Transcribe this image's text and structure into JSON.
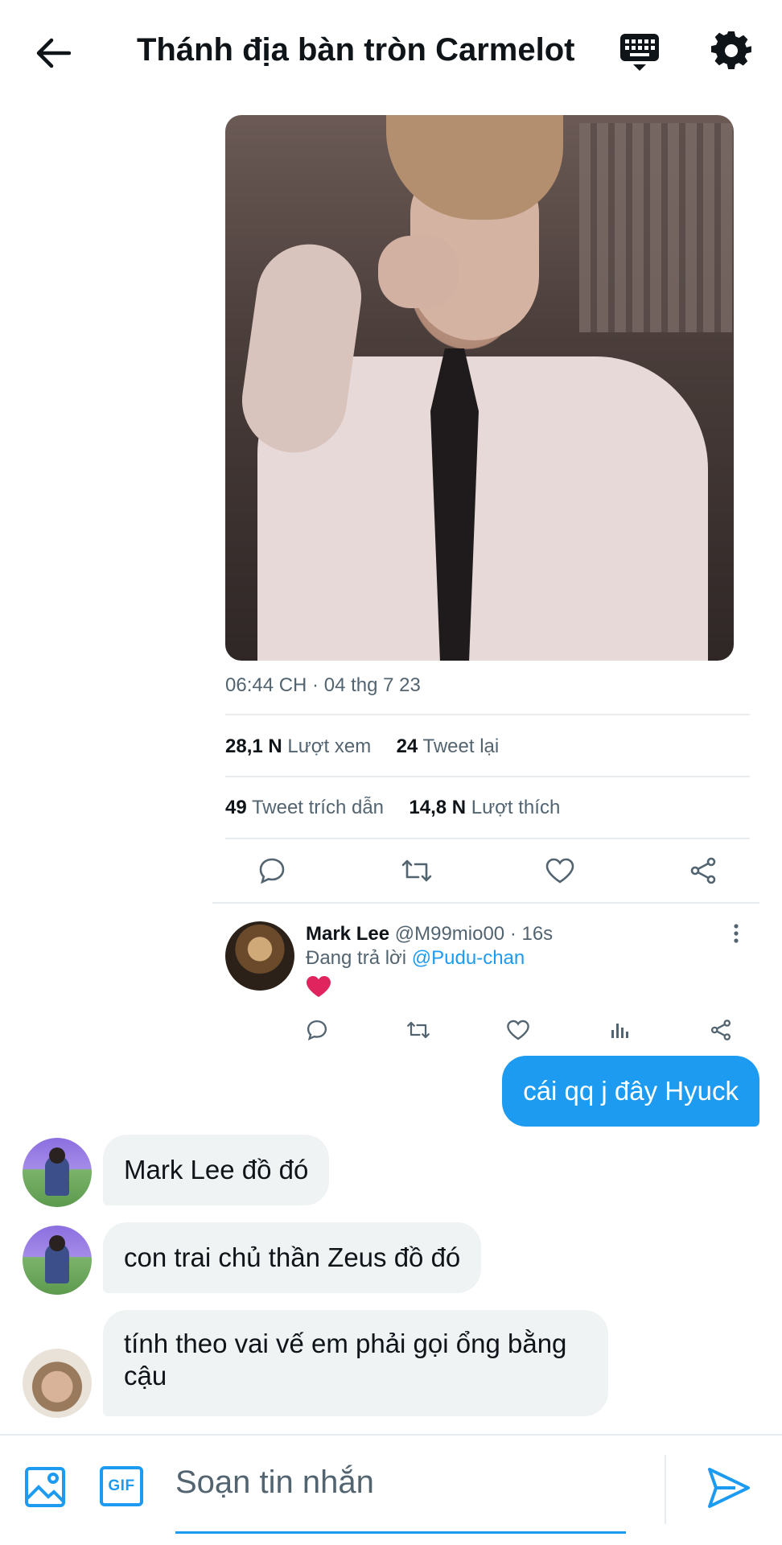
{
  "header": {
    "title": "Thánh địa bàn tròn Carmelot"
  },
  "tweet": {
    "timestamp": "06:44 CH · 04 thg 7 23",
    "views_count": "28,1 N",
    "views_label": "Lượt xem",
    "retweets_count": "24",
    "retweets_label": "Tweet lại",
    "quotes_count": "49",
    "quotes_label": "Tweet trích dẫn",
    "likes_count": "14,8 N",
    "likes_label": "Lượt thích"
  },
  "reply": {
    "name": "Mark Lee",
    "handle_time": "@M99mio00 · 16s",
    "replying_prefix": "Đang trả lời",
    "mention": "@Pudu-chan"
  },
  "messages": [
    {
      "direction": "out",
      "text": "cái qq j đây Hyuck"
    },
    {
      "direction": "in",
      "text": "Mark Lee đồ đó"
    },
    {
      "direction": "in",
      "text": "con trai chủ thần Zeus đồ đó"
    },
    {
      "direction": "in",
      "text": "tính theo vai vế em phải gọi ổng bằng cậu"
    }
  ],
  "composer": {
    "gif_label": "GIF",
    "placeholder": "Soạn tin nhắn"
  },
  "colors": {
    "accent": "#1d9bf0",
    "incoming_bubble": "#eff3f4",
    "secondary_text": "#536471",
    "heart": "#e0245e"
  }
}
